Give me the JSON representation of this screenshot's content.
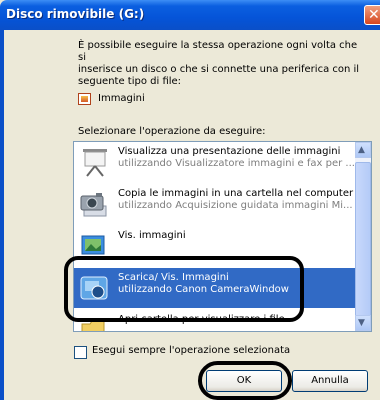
{
  "window": {
    "title": "Disco rimovibile (G:)"
  },
  "description": {
    "lines": [
      "È possibile eseguire la stessa operazione ogni volta che si",
      "inserisce un disco o che si connette una periferica con il",
      "seguente tipo di file:"
    ]
  },
  "file_type": {
    "icon": "pictures-icon",
    "label": "Immagini"
  },
  "select_label": "Selezionare l'operazione da eseguire:",
  "actions": [
    {
      "line1": "Visualizza una presentazione delle immagini",
      "line2": "utilizzando Visualizzatore immagini e fax per ...",
      "icon": "projector-screen-icon",
      "selected": false
    },
    {
      "line1": "Copia le immagini in una cartella nel computer",
      "line2": "utilizzando Acquisizione guidata immagini Mi...",
      "icon": "camera-icon",
      "selected": false
    },
    {
      "line1": "Vis. immagini",
      "line2": "",
      "icon": "picture-viewer-icon",
      "selected": false
    },
    {
      "line1": "Scarica/ Vis. Immagini",
      "line2": "utilizzando Canon CameraWindow",
      "icon": "canon-camerawindow-icon",
      "selected": true
    },
    {
      "line1": "Apri cartella per visualizzare i file",
      "line2": "",
      "icon": "folder-icon",
      "selected": false
    }
  ],
  "checkbox": {
    "label": "Esegui sempre l'operazione selezionata",
    "checked": false
  },
  "buttons": {
    "ok": "OK",
    "cancel": "Annulla"
  },
  "colors": {
    "selection": "#316ac5",
    "titlebar": "#0554d8",
    "highlight_ring": "#000000"
  }
}
